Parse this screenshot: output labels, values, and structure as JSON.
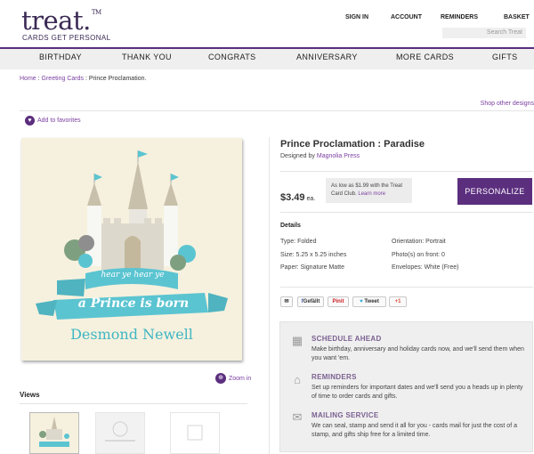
{
  "header": {
    "logo": "treat.",
    "logo_mark": "TM",
    "tagline": "CARDS GET PERSONAL",
    "nav": [
      "SIGN IN",
      "ACCOUNT",
      "REMINDERS",
      "BASKET"
    ],
    "search_placeholder": "Search Treat"
  },
  "categories": [
    "BIRTHDAY",
    "THANK YOU",
    "CONGRATS",
    "ANNIVERSARY",
    "MORE CARDS",
    "GIFTS"
  ],
  "breadcrumb": {
    "home": "Home",
    "sep1": " : ",
    "greeting": "Greeting Cards",
    "sep2": " : ",
    "current": "Prince Proclamation."
  },
  "shop_other": "Shop other designs",
  "favorites": "Add to favorites",
  "card": {
    "line1": "hear ye hear ye",
    "line2": "a Prince is born",
    "name": "Desmond Newell"
  },
  "zoom": "Zoom in",
  "views_label": "Views",
  "product": {
    "title": "Prince Proclamation : Paradise",
    "designed_prefix": "Designed by ",
    "designer": "Magnolia Press",
    "price": "$3.49",
    "price_unit": " ea.",
    "club_text": "As low as $1.99 with the Treat Card Club.",
    "club_link": "Learn more",
    "personalize": "PERSONALIZE"
  },
  "details": {
    "heading": "Details",
    "left": [
      "Type: Folded",
      "Size: 5.25 x 5.25 inches",
      "Paper: Signature Matte"
    ],
    "right": [
      "Orientation: Portrait",
      "Photo(s) on front: 0",
      "Envelopes: White (Free)"
    ]
  },
  "social": {
    "facebook": "Gefällt",
    "pinterest": "Pinit",
    "twitter": "Tweet",
    "gplus": "+1"
  },
  "info": [
    {
      "title": "SCHEDULE AHEAD",
      "text": "Make birthday, anniversary and holiday cards now, and we'll send them when you want 'em.",
      "icon": "calendar-icon"
    },
    {
      "title": "REMINDERS",
      "text": "Set up reminders for important dates and we'll send you a heads up in plenty of time to order cards and gifts.",
      "icon": "bell-icon"
    },
    {
      "title": "MAILING SERVICE",
      "text": "We can seal, stamp and send it all for you - cards mail for just the cost of a stamp, and gifts ship free for a limited time.",
      "icon": "envelope-icon"
    }
  ],
  "colors": {
    "brand": "#5b2e7e",
    "ribbon": "#5bc4d1",
    "card_bg": "#f6f1de"
  }
}
